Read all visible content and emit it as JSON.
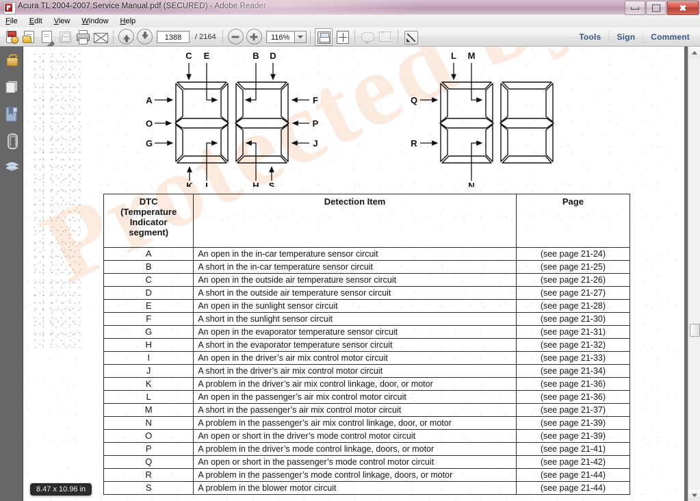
{
  "window": {
    "title": "Acura TL 2004-2007 Service Manual.pdf (SECURED) - Adobe Reader",
    "app_icon": "adobe-reader-icon",
    "controls": {
      "minimize": "–",
      "restore": "❐",
      "close": "✕"
    }
  },
  "menu": {
    "items": [
      {
        "label": "File"
      },
      {
        "label": "Edit"
      },
      {
        "label": "View"
      },
      {
        "label": "Window"
      },
      {
        "label": "Help"
      }
    ]
  },
  "toolbar": {
    "create_pdf_tooltip": "Create PDF",
    "export_pdf_tooltip": "Export PDF",
    "edit_pdf_tooltip": "Edit PDF",
    "save_tooltip": "Save",
    "print_tooltip": "Print",
    "email_tooltip": "Email",
    "prev_page_tooltip": "Previous Page",
    "next_page_tooltip": "Next Page",
    "current_page": "1388",
    "page_separator": "/",
    "total_pages": "2164",
    "zoom_out_tooltip": "Zoom Out",
    "zoom_in_tooltip": "Zoom In",
    "zoom_level": "116%",
    "zoom_dropdown_tooltip": "Zoom Level",
    "save_file_tooltip": "Save File",
    "fit_page_tooltip": "Fit Page",
    "sticky_note_tooltip": "Sticky Note",
    "highlight_text_tooltip": "Highlight Text",
    "fullscreen_tooltip": "Read Mode",
    "tools_label": "Tools",
    "sign_label": "Sign",
    "comment_label": "Comment"
  },
  "navpane": {
    "items": [
      {
        "name": "security-lock",
        "label": "Security Settings"
      },
      {
        "name": "page-thumbnails",
        "label": "Page Thumbnails"
      },
      {
        "name": "bookmarks",
        "label": "Bookmarks"
      },
      {
        "name": "attachments",
        "label": "Attachments"
      },
      {
        "name": "layers",
        "label": "Layers"
      }
    ]
  },
  "document": {
    "watermark_text": "Protected by A",
    "page_size_tooltip": "8.47 x 10.96 in",
    "diagram": {
      "caption": "",
      "left_group_labels": {
        "top": [
          "C",
          "E",
          "B",
          "D"
        ],
        "left": [
          "A",
          "O",
          "G"
        ],
        "right": [
          "F",
          "P",
          "J"
        ],
        "bottom": [
          "K",
          "I",
          "H",
          "S"
        ]
      },
      "right_group_labels": {
        "top": [
          "L",
          "M"
        ],
        "left": [
          "Q",
          "R"
        ],
        "bottom": [
          "N"
        ]
      }
    },
    "table": {
      "headers": {
        "dtc": "DTC\n(Temperature\nIndicator\nsegment)",
        "dtc_line1": "DTC",
        "dtc_line2": "(Temperature",
        "dtc_line3": "Indicator",
        "dtc_line4": "segment)",
        "detection": "Detection Item",
        "page": "Page"
      },
      "rows": [
        {
          "dtc": "A",
          "detection": "An open in the in-car temperature sensor circuit",
          "page": "(see page 21-24)"
        },
        {
          "dtc": "B",
          "detection": "A short in the in-car temperature sensor circuit",
          "page": "(see page 21-25)"
        },
        {
          "dtc": "C",
          "detection": "An open in the outside air temperature sensor circuit",
          "page": "(see page 21-26)"
        },
        {
          "dtc": "D",
          "detection": "A short in the outside air temperature sensor circuit",
          "page": "(see page 21-27)"
        },
        {
          "dtc": "E",
          "detection": "An open in the sunlight sensor circuit",
          "page": "(see page 21-28)"
        },
        {
          "dtc": "F",
          "detection": "A short in the sunlight sensor circuit",
          "page": "(see page 21-30)"
        },
        {
          "dtc": "G",
          "detection": "An open in the evaporator temperature sensor circuit",
          "page": "(see page 21-31)"
        },
        {
          "dtc": "H",
          "detection": "A short in the evaporator temperature sensor circuit",
          "page": "(see page 21-32)"
        },
        {
          "dtc": "I",
          "detection": "An open in the driver’s air mix control motor circuit",
          "page": "(see page 21-33)"
        },
        {
          "dtc": "J",
          "detection": "A short in the driver’s air mix control motor circuit",
          "page": "(see page 21-34)"
        },
        {
          "dtc": "K",
          "detection": "A problem in the driver’s air mix control linkage, door, or motor",
          "page": "(see page 21-36)"
        },
        {
          "dtc": "L",
          "detection": "An open in the passenger’s air mix control motor circuit",
          "page": "(see page 21-36)"
        },
        {
          "dtc": "M",
          "detection": "A short in the passenger’s air mix control motor circuit",
          "page": "(see page 21-37)"
        },
        {
          "dtc": "N",
          "detection": "A problem in the passenger’s air mix control linkage, door, or motor",
          "page": "(see page 21-39)"
        },
        {
          "dtc": "O",
          "detection": "An open or short in the driver’s mode control motor circuit",
          "page": "(see page 21-39)"
        },
        {
          "dtc": "P",
          "detection": "A problem in the driver’s mode control linkage, doors, or motor",
          "page": "(see page 21-41)"
        },
        {
          "dtc": "Q",
          "detection": "An open or short in the passenger’s mode control motor circuit",
          "page": "(see page 21-42)"
        },
        {
          "dtc": "R",
          "detection": "A problem in the passenger’s mode control linkage, doors, or motor",
          "page": "(see page 21-44)"
        },
        {
          "dtc": "S",
          "detection": "A problem in the blower motor circuit",
          "page": "(see page 21-44)"
        }
      ]
    }
  },
  "colors": {
    "titlebar_accent": "#c9a9bd",
    "close_button": "#b53f33",
    "toolbar_link": "#3b5a86",
    "navpane_bg": "#676767",
    "lock_gold": "#c79a33",
    "watermark": "#f0a06e"
  }
}
